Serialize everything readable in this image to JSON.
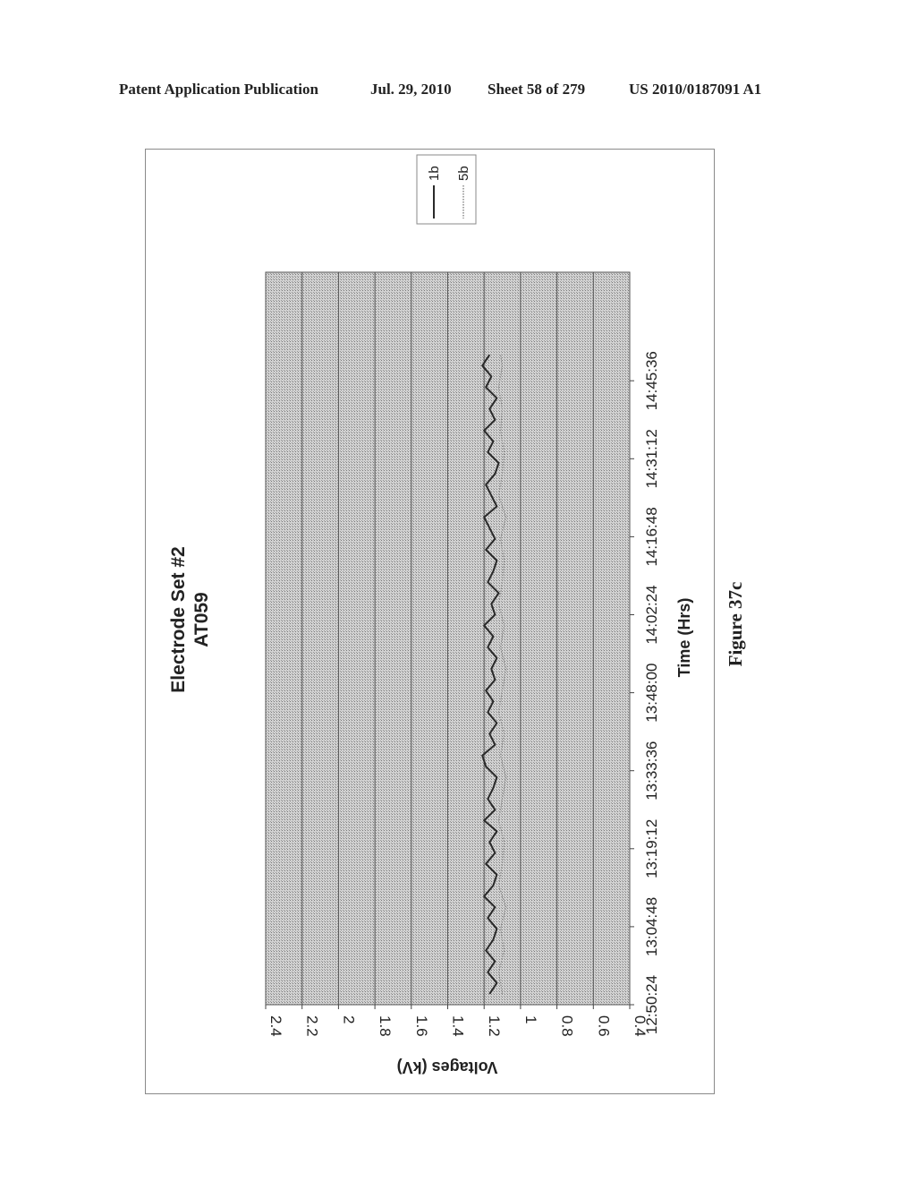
{
  "header": {
    "publication": "Patent Application Publication",
    "date": "Jul. 29, 2010",
    "sheet": "Sheet 58 of 279",
    "patent_number": "US 2010/0187091 A1"
  },
  "figure_label": "Figure 37c",
  "chart_data": {
    "type": "line",
    "title": "Electrode Set #2",
    "subtitle": "AT059",
    "xlabel": "Time (Hrs)",
    "ylabel": "Voltages (kV)",
    "orientation": "rotated 90° counter-clockwise on page",
    "x_tick_labels": [
      "12:50:24",
      "13:04:48",
      "13:19:12",
      "13:33:36",
      "13:48:00",
      "14:02:24",
      "14:16:48",
      "14:31:12",
      "14:45:36"
    ],
    "x_range_minutes_from_start": [
      0,
      124
    ],
    "y_tick_labels": [
      "0.4",
      "0.6",
      "0.8",
      "1",
      "1.2",
      "1.4",
      "1.6",
      "1.8",
      "2",
      "2.2",
      "2.4"
    ],
    "ylim": [
      0.4,
      2.4
    ],
    "y_gridlines": true,
    "plot_background": "stippled grey",
    "legend": {
      "position": "top-right",
      "entries": [
        "1b",
        "5b"
      ]
    },
    "series": [
      {
        "name": "1b",
        "style": "solid dark",
        "color": "#2a2a2a",
        "x_minutes": [
          2,
          4,
          6,
          8,
          10,
          12,
          14,
          16,
          18,
          20,
          22,
          24,
          26,
          28,
          30,
          32,
          34,
          36,
          38,
          40,
          42,
          44,
          46,
          48,
          50,
          52,
          54,
          56,
          58,
          60,
          62,
          64,
          66,
          68,
          70,
          72,
          74,
          76,
          78,
          80,
          82,
          84,
          86,
          88,
          90,
          92,
          94,
          96,
          98,
          100,
          102,
          104,
          106,
          108,
          110,
          112,
          114,
          116,
          118,
          120
        ],
        "values": [
          1.17,
          1.13,
          1.18,
          1.14,
          1.19,
          1.15,
          1.13,
          1.18,
          1.14,
          1.2,
          1.15,
          1.13,
          1.19,
          1.14,
          1.17,
          1.13,
          1.2,
          1.14,
          1.18,
          1.15,
          1.13,
          1.19,
          1.21,
          1.14,
          1.17,
          1.13,
          1.18,
          1.15,
          1.19,
          1.14,
          1.16,
          1.13,
          1.18,
          1.15,
          1.2,
          1.14,
          1.16,
          1.12,
          1.18,
          1.15,
          1.13,
          1.19,
          1.14,
          1.17,
          1.2,
          1.13,
          1.16,
          1.19,
          1.14,
          1.12,
          1.18,
          1.15,
          1.2,
          1.14,
          1.17,
          1.13,
          1.19,
          1.16,
          1.21,
          1.17
        ]
      },
      {
        "name": "5b",
        "style": "dotted light",
        "color": "#8a8a8a",
        "x_minutes": [
          2,
          6,
          10,
          14,
          18,
          22,
          26,
          30,
          34,
          38,
          42,
          46,
          50,
          54,
          58,
          62,
          66,
          70,
          74,
          78,
          82,
          86,
          90,
          94,
          98,
          102,
          106,
          110,
          114,
          118,
          120
        ],
        "values": [
          1.1,
          1.12,
          1.09,
          1.11,
          1.08,
          1.12,
          1.1,
          1.09,
          1.12,
          1.1,
          1.08,
          1.11,
          1.09,
          1.12,
          1.1,
          1.08,
          1.11,
          1.09,
          1.12,
          1.1,
          1.09,
          1.11,
          1.08,
          1.12,
          1.1,
          1.09,
          1.11,
          1.1,
          1.12,
          1.1,
          1.11
        ]
      }
    ]
  }
}
